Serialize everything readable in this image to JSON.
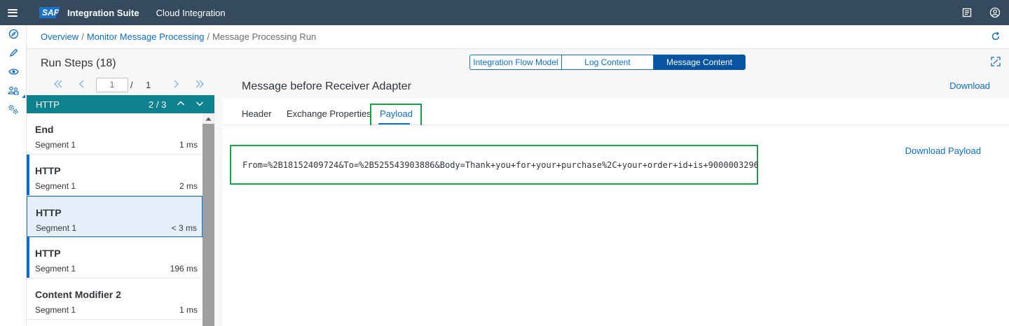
{
  "shell": {
    "logo": "SAP",
    "product": "Integration Suite",
    "subtitle": "Cloud Integration",
    "icons": [
      "menu-icon",
      "notes-icon",
      "user-icon"
    ]
  },
  "sidenav": {
    "icons": [
      "discover-icon",
      "design-icon",
      "monitor-icon",
      "manage-users-icon",
      "settings-icon"
    ]
  },
  "breadcrumb": {
    "items": [
      "Overview",
      "Monitor Message Processing"
    ],
    "separator": "/",
    "current": "Message Processing Run",
    "refresh_icon": "refresh-icon"
  },
  "run_steps": {
    "title": "Run Steps (18)",
    "page_current": "1",
    "page_separator": "/",
    "page_total": "1",
    "filter_label": "HTTP",
    "filter_count": "2 / 3",
    "items": [
      {
        "name": "End",
        "segment": "Segment 1",
        "duration": "1 ms"
      },
      {
        "name": "HTTP",
        "segment": "Segment 1",
        "duration": "2 ms"
      },
      {
        "name": "HTTP",
        "segment": "Segment 1",
        "duration": "< 3 ms"
      },
      {
        "name": "HTTP",
        "segment": "Segment 1",
        "duration": "196 ms"
      },
      {
        "name": "Content Modifier 2",
        "segment": "Segment 1",
        "duration": "1 ms"
      }
    ]
  },
  "view_switch": {
    "options": [
      "Integration Flow Model",
      "Log Content",
      "Message Content"
    ],
    "selected": "Message Content"
  },
  "message": {
    "title": "Message before Receiver Adapter",
    "download": "Download",
    "tabs": [
      "Header",
      "Exchange Properties",
      "Payload"
    ],
    "active_tab": "Payload",
    "payload": "From=%2B18152409724&To=%2B525543903886&Body=Thank+you+for+your+purchase%2C+your+order+id+is+9000003296",
    "download_payload": "Download Payload"
  },
  "colors": {
    "shell": "#354a5f",
    "accent": "#0a6ed1",
    "filter_bar": "#0f828f",
    "highlight_box": "#1aa24a",
    "selected_row": "#e5f0fa"
  }
}
